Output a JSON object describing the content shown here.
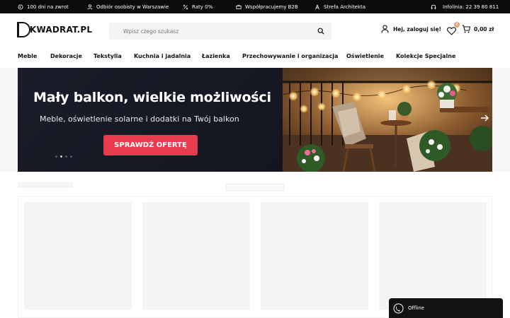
{
  "topbar": {
    "items": [
      {
        "icon": "return-icon",
        "label": "100 dni na zwrot"
      },
      {
        "icon": "pickup-icon",
        "label": "Odbiór osobisty w Warszawie"
      },
      {
        "icon": "percent-icon",
        "label": "Raty 0%"
      },
      {
        "icon": "b2b-icon",
        "label": "Współpracujemy B2B"
      },
      {
        "icon": "architect-icon",
        "label": "Strefa Architekta"
      }
    ],
    "hotline": {
      "icon": "headset-icon",
      "label": "Infolinia: 22 39 80 811"
    }
  },
  "header": {
    "logo_text": "KWADRAT.PL",
    "search_placeholder": "Wpisz czego szukasz",
    "account_label": "Hej, zaloguj się!",
    "favorites_count": "0",
    "cart_total": "0,00 zł"
  },
  "nav": {
    "items": [
      "Meble",
      "Dekoracje",
      "Tekstylia",
      "Kuchnia i jadalnia",
      "Łazienka",
      "Przechowywanie i organizacja",
      "Oświetlenie",
      "Kolekcje Specjalne"
    ]
  },
  "hero": {
    "title": "Mały balkon, wielkie możliwości",
    "subtitle": "Meble, oświetlenie solarne i dodatki na Twój balkon",
    "cta": "SPRAWDŹ OFERTĘ",
    "slide_count": 4,
    "active_slide": 2
  },
  "chat": {
    "status": "Offline"
  }
}
